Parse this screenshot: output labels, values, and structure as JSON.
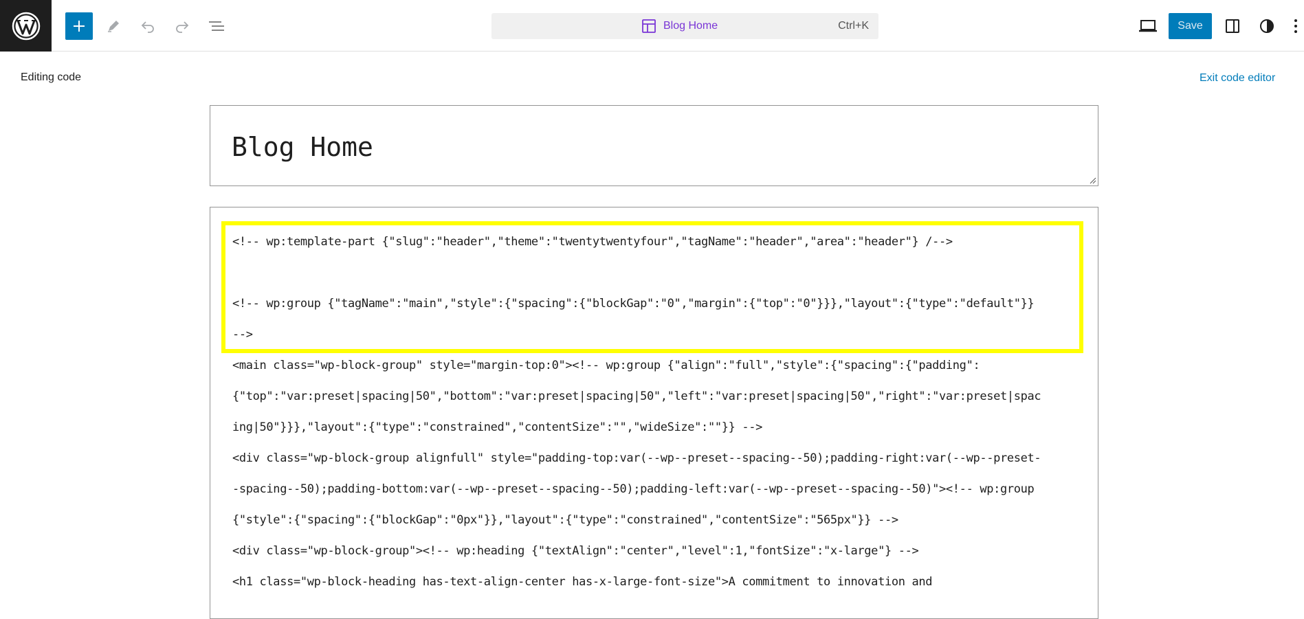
{
  "toolbar": {
    "logo_icon": "wordpress-logo",
    "document_title": "Blog Home",
    "shortcut": "Ctrl+K",
    "save_label": "Save",
    "accent_color": "#007cba",
    "template_color": "#7a36d6"
  },
  "editor": {
    "mode_label": "Editing code",
    "exit_label": "Exit code editor",
    "title_value": "Blog Home",
    "code_lines": [
      "<!-- wp:template-part {\"slug\":\"header\",\"theme\":\"twentytwentyfour\",\"tagName\":\"header\",\"area\":\"header\"} /-->",
      "",
      "<!-- wp:group {\"tagName\":\"main\",\"style\":{\"spacing\":{\"blockGap\":\"0\",\"margin\":{\"top\":\"0\"}}},\"layout\":{\"type\":\"default\"}}",
      "-->",
      "<main class=\"wp-block-group\" style=\"margin-top:0\"><!-- wp:group {\"align\":\"full\",\"style\":{\"spacing\":{\"padding\":",
      "{\"top\":\"var:preset|spacing|50\",\"bottom\":\"var:preset|spacing|50\",\"left\":\"var:preset|spacing|50\",\"right\":\"var:preset|spac",
      "ing|50\"}}},\"layout\":{\"type\":\"constrained\",\"contentSize\":\"\",\"wideSize\":\"\"}} -->",
      "<div class=\"wp-block-group alignfull\" style=\"padding-top:var(--wp--preset--spacing--50);padding-right:var(--wp--preset-",
      "-spacing--50);padding-bottom:var(--wp--preset--spacing--50);padding-left:var(--wp--preset--spacing--50)\"><!-- wp:group",
      "{\"style\":{\"spacing\":{\"blockGap\":\"0px\"}},\"layout\":{\"type\":\"constrained\",\"contentSize\":\"565px\"}} -->",
      "<div class=\"wp-block-group\"><!-- wp:heading {\"textAlign\":\"center\",\"level\":1,\"fontSize\":\"x-large\"} -->",
      "<h1 class=\"wp-block-heading has-text-align-center has-x-large-font-size\">A commitment to innovation and"
    ],
    "highlight_color": "#ffff00"
  }
}
